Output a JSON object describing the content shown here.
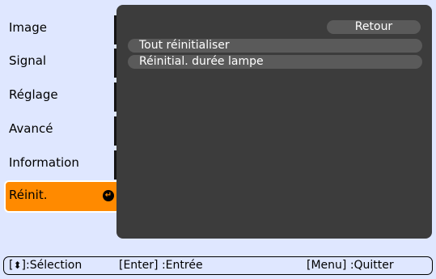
{
  "sidebar": {
    "items": [
      {
        "label": "Image"
      },
      {
        "label": "Signal"
      },
      {
        "label": "Réglage"
      },
      {
        "label": "Avancé"
      },
      {
        "label": "Information"
      },
      {
        "label": "Réinit."
      }
    ],
    "active_index": 5,
    "active_icon": "enter-icon"
  },
  "panel": {
    "back_label": "Retour",
    "options": [
      {
        "label": "Tout réinitialiser"
      },
      {
        "label": "Réinitial. durée lampe"
      }
    ]
  },
  "statusbar": {
    "select_icon": "up-down-arrows-icon",
    "select_prefix": "[",
    "select_suffix": "]:Sélection",
    "enter_text": "[Enter] :Entrée",
    "menu_text": "[Menu] :Quitter"
  },
  "colors": {
    "background": "#dfe7ff",
    "panel": "#3c3c3c",
    "active": "#ff8a00",
    "pill": "#5a5a5a"
  }
}
